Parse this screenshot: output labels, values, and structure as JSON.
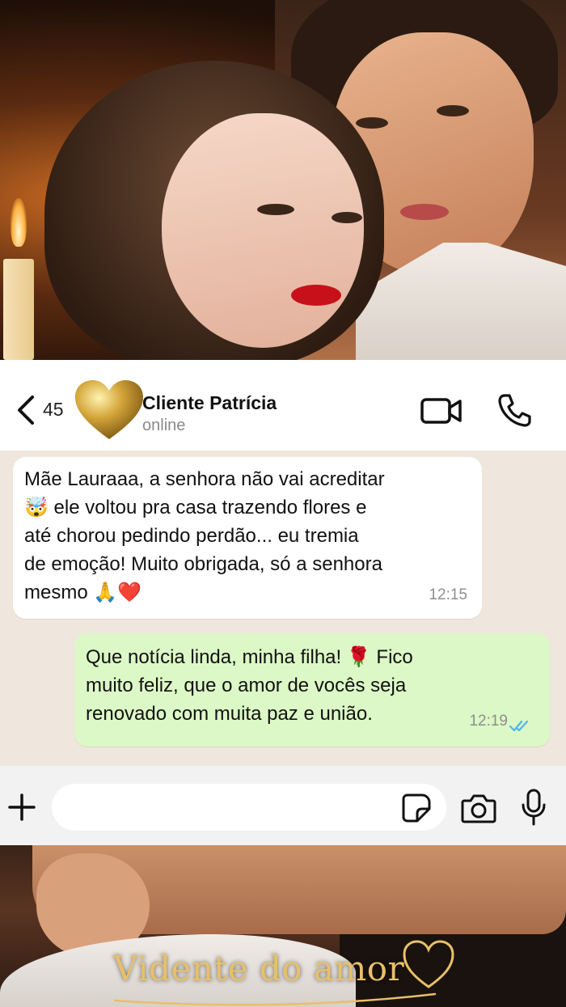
{
  "header": {
    "unread_count": "45",
    "contact_name": "Cliente Patrícia",
    "contact_status": "online"
  },
  "messages": [
    {
      "direction": "incoming",
      "lines": [
        "Mãe Lauraaa, a senhora não vai acreditar",
        "🤯 ele voltou pra casa trazendo flores e",
        "até chorou pedindo perdão... eu tremia",
        "de emoção! Muito obrigada, só a senhora",
        "mesmo 🙏❤️"
      ],
      "time": "12:15"
    },
    {
      "direction": "outgoing",
      "lines": [
        "Que notícia linda, minha filha! 🌹 Fico",
        "muito feliz, que o amor de vocês seja",
        "renovado com muita paz e união."
      ],
      "time": "12:19",
      "status": "read"
    }
  ],
  "input": {
    "placeholder": "",
    "value": ""
  },
  "brand": {
    "text": "Vidente do amor"
  },
  "icons": {
    "back": "chevron-left-icon",
    "avatar": "gold-heart-icon",
    "video": "video-call-icon",
    "phone": "phone-icon",
    "plus": "plus-icon",
    "sticker": "sticker-icon",
    "camera": "camera-icon",
    "mic": "microphone-icon"
  },
  "colors": {
    "incoming_bubble": "#ffffff",
    "outgoing_bubble": "#dcf8c6",
    "read_ticks": "#4fb6ec",
    "brand_gold": "#e8c06a",
    "chat_background": "#efe7de"
  }
}
